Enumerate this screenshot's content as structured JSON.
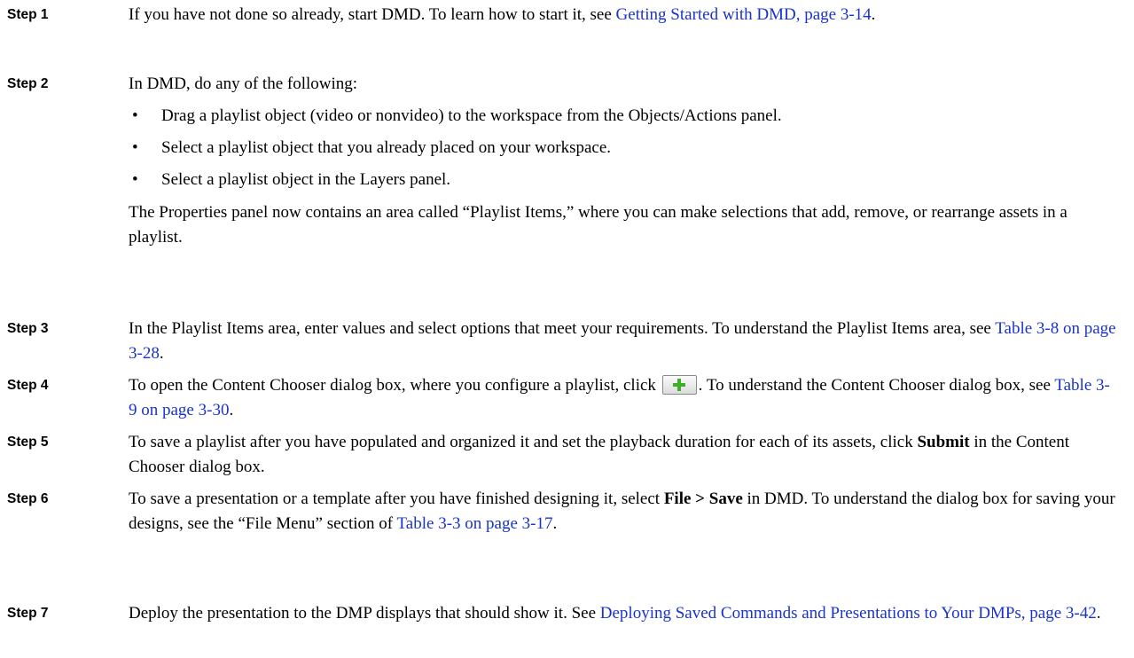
{
  "steps": [
    {
      "label": "Step 1",
      "t1": "If you have not done so already, start DMD. To learn how to start it, see ",
      "link1": "Getting Started with DMD, page 3-14",
      "t2": "."
    },
    {
      "label": "Step 2",
      "t1": "In DMD, do any of the following:",
      "bullets": [
        "Drag a playlist object (video or nonvideo) to the workspace from the Objects/Actions panel.",
        "Select a playlist object that you already placed on your workspace.",
        "Select a playlist object in the Layers panel."
      ],
      "after": "The Properties panel now contains an area called “Playlist Items,” where you can make selections that add, remove, or rearrange assets in a playlist."
    },
    {
      "label": "Step 3",
      "t1": "In the Playlist Items area, enter values and select options that meet your requirements. To understand the Playlist Items area, see ",
      "link1": "Table 3-8 on page 3-28",
      "t2": "."
    },
    {
      "label": "Step 4",
      "t1": "To open the Content Chooser dialog box, where you configure a playlist, click ",
      "t2": ". To understand the Content Chooser dialog box, see ",
      "link1": "Table 3-9 on page 3-30",
      "t3": "."
    },
    {
      "label": "Step 5",
      "t1": "To save a playlist after you have populated and organized it and set the playback duration for each of its assets, click ",
      "bold1": "Submit",
      "t2": " in the Content Chooser dialog box."
    },
    {
      "label": "Step 6",
      "t1": "To save a presentation or a template after you have finished designing it, select ",
      "bold1": "File > Save",
      "t2": " in DMD. To understand the dialog box for saving your designs, see the “File Menu” section of ",
      "link1": "Table 3-3 on page 3-17",
      "t3": "."
    },
    {
      "label": "Step 7",
      "t1": "Deploy the presentation to the DMP displays that should show it. See ",
      "link1": "Deploying Saved Commands and Presentations to Your DMPs, page 3-42",
      "t2": "."
    }
  ],
  "icons": {
    "bullet": "bullet-dot",
    "add_button": "green-plus-icon"
  },
  "colors": {
    "link": "#1a33cc",
    "plus": "#3fae2a"
  }
}
